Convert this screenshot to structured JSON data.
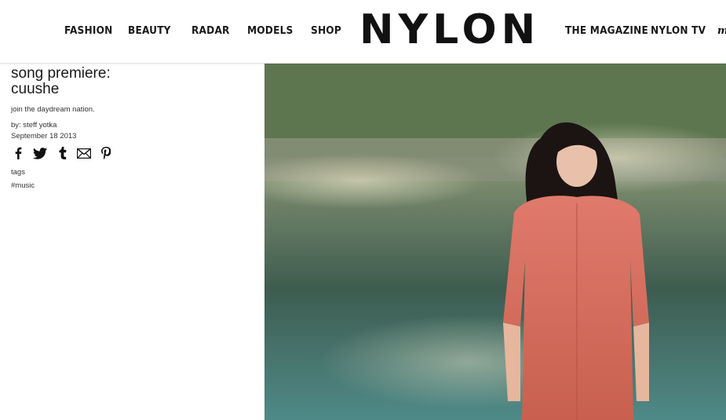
{
  "header": {
    "nav_left": [
      "FASHION",
      "BEAUTY",
      "RADAR",
      "MODELS",
      "SHOP"
    ],
    "logo": "NYLON",
    "nav_right": [
      "THE MAGAZINE",
      "NYLON TV"
    ],
    "nav_more": "m"
  },
  "article": {
    "title_line1": "song premiere:",
    "title_line2": "cuushe",
    "dek": "join the daydream nation.",
    "byline": "by: steff yotka",
    "date": "September 18 2013",
    "share_icons": [
      "facebook-icon",
      "twitter-icon",
      "tumblr-icon",
      "email-icon",
      "pinterest-icon"
    ],
    "tags_label": "tags",
    "tags": [
      "#music"
    ]
  },
  "hero": {
    "description_colors": {
      "dress": "#d46a5f",
      "hair": "#1b1412",
      "foliage": "#4f6b4a"
    }
  }
}
